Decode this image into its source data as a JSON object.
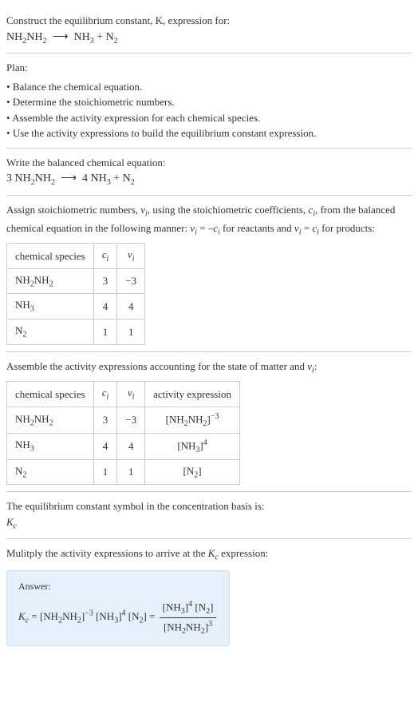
{
  "intro": {
    "prompt": "Construct the equilibrium constant, K, expression for:",
    "equation_html": "NH<sub>2</sub>NH<sub>2</sub> &nbsp;⟶&nbsp; NH<sub>3</sub> + N<sub>2</sub>"
  },
  "plan": {
    "title": "Plan:",
    "items": [
      "Balance the chemical equation.",
      "Determine the stoichiometric numbers.",
      "Assemble the activity expression for each chemical species.",
      "Use the activity expressions to build the equilibrium constant expression."
    ]
  },
  "balanced": {
    "prompt": "Write the balanced chemical equation:",
    "equation_html": "3 NH<sub>2</sub>NH<sub>2</sub> &nbsp;⟶&nbsp; 4 NH<sub>3</sub> + N<sub>2</sub>"
  },
  "stoich": {
    "prompt_html": "Assign stoichiometric numbers, <span class='italic'>ν<sub>i</sub></span>, using the stoichiometric coefficients, <span class='italic'>c<sub>i</sub></span>, from the balanced chemical equation in the following manner: <span class='italic'>ν<sub>i</sub></span> = –<span class='italic'>c<sub>i</sub></span> for reactants and <span class='italic'>ν<sub>i</sub></span> = <span class='italic'>c<sub>i</sub></span> for products:",
    "headers": [
      "chemical species",
      "c_i",
      "ν_i"
    ],
    "rows": [
      {
        "species_html": "NH<sub>2</sub>NH<sub>2</sub>",
        "c": "3",
        "v": "−3"
      },
      {
        "species_html": "NH<sub>3</sub>",
        "c": "4",
        "v": "4"
      },
      {
        "species_html": "N<sub>2</sub>",
        "c": "1",
        "v": "1"
      }
    ]
  },
  "activity": {
    "prompt_html": "Assemble the activity expressions accounting for the state of matter and <span class='italic'>ν<sub>i</sub></span>:",
    "headers": [
      "chemical species",
      "c_i",
      "ν_i",
      "activity expression"
    ],
    "rows": [
      {
        "species_html": "NH<sub>2</sub>NH<sub>2</sub>",
        "c": "3",
        "v": "−3",
        "act_html": "[NH<sub>2</sub>NH<sub>2</sub>]<sup>−3</sup>"
      },
      {
        "species_html": "NH<sub>3</sub>",
        "c": "4",
        "v": "4",
        "act_html": "[NH<sub>3</sub>]<sup>4</sup>"
      },
      {
        "species_html": "N<sub>2</sub>",
        "c": "1",
        "v": "1",
        "act_html": "[N<sub>2</sub>]"
      }
    ]
  },
  "kc_symbol": {
    "prompt": "The equilibrium constant symbol in the concentration basis is:",
    "symbol_html": "<span class='italic'>K<sub>c</sub></span>"
  },
  "multiply": {
    "prompt_html": "Mulitply the activity expressions to arrive at the <span class='italic'>K<sub>c</sub></span> expression:"
  },
  "answer": {
    "label": "Answer:",
    "lhs_html": "<span class='italic'>K<sub>c</sub></span> = [NH<sub>2</sub>NH<sub>2</sub>]<sup>−3</sup> [NH<sub>3</sub>]<sup>4</sup> [N<sub>2</sub>] =",
    "num_html": "[NH<sub>3</sub>]<sup>4</sup> [N<sub>2</sub>]",
    "den_html": "[NH<sub>2</sub>NH<sub>2</sub>]<sup>3</sup>"
  }
}
